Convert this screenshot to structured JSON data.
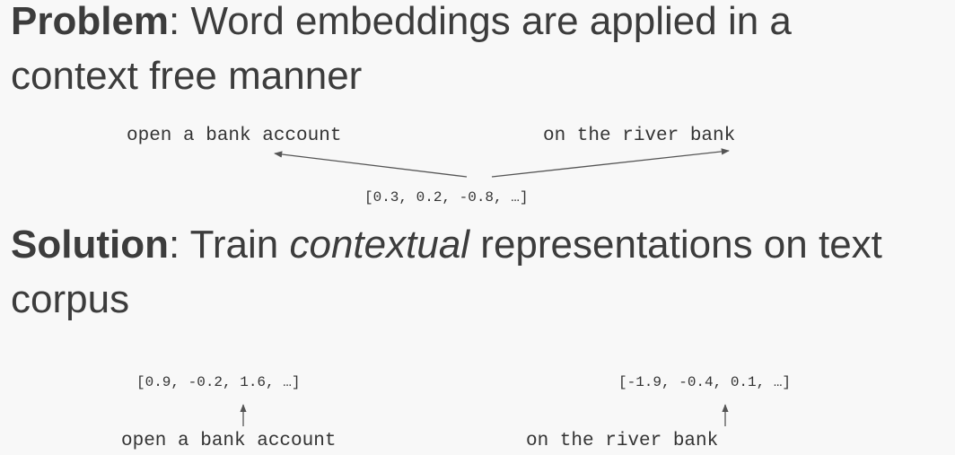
{
  "problem": {
    "label": "Problem",
    "separator": ":",
    "line1": " Word embeddings are applied in a",
    "line2": "context free manner"
  },
  "problem_diagram": {
    "phrase_left": "open a bank account",
    "phrase_right": "on the river bank",
    "shared_vector": "[0.3, 0.2, -0.8, …]"
  },
  "solution": {
    "label": "Solution",
    "separator": ":",
    "text_before": " Train ",
    "emphasis": "contextual",
    "text_after": " representations on text",
    "line2": "corpus"
  },
  "solution_diagram": {
    "vector_left": "[0.9, -0.2, 1.6, …]",
    "vector_right": "[-1.9, -0.4, 0.1, …]",
    "phrase_left": "open a bank account",
    "phrase_right": "on the river bank"
  },
  "colors": {
    "background": "#f8f8f8",
    "heading_text": "#3c3c3c",
    "diagram_text": "#333333",
    "arrow": "#555555"
  }
}
